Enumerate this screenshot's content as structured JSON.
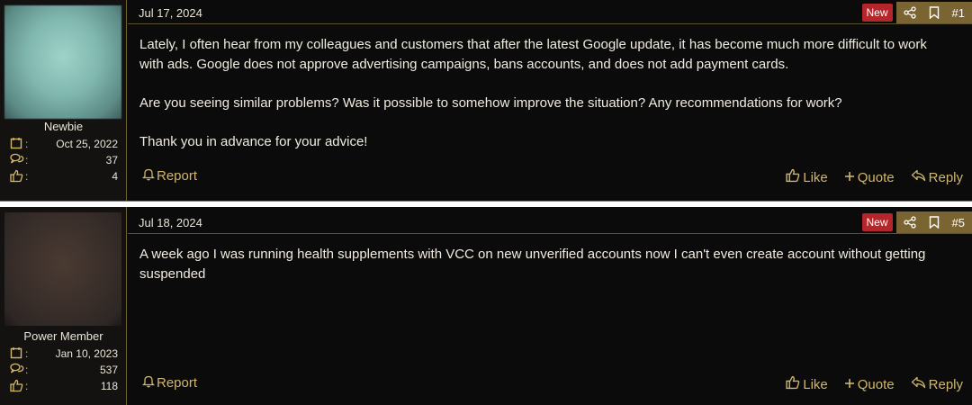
{
  "posts": [
    {
      "date": "Jul 17, 2024",
      "badge": "New",
      "post_number": "#1",
      "user": {
        "rank": "Newbie",
        "joined": "Oct 25, 2022",
        "messages": "37",
        "reactions": "4"
      },
      "body": [
        "Lately, I often hear from my colleagues and customers that after the latest Google update, it has become much more difficult to work with ads. Google does not approve advertising campaigns, bans accounts, and does not add payment cards.",
        "Are you seeing similar problems? Was it possible to somehow improve the situation? Any recommendations for work?",
        "Thank you in advance for your advice!"
      ],
      "report_label": "Report",
      "like_label": "Like",
      "quote_label": "Quote",
      "reply_label": "Reply"
    },
    {
      "date": "Jul 18, 2024",
      "badge": "New",
      "post_number": "#5",
      "user": {
        "rank": "Power Member",
        "joined": "Jan 10, 2023",
        "messages": "537",
        "reactions": "118"
      },
      "body": [
        "A week ago I was running health supplements with VCC on new unverified accounts now I can't even create account without getting suspended"
      ],
      "report_label": "Report",
      "like_label": "Like",
      "quote_label": "Quote",
      "reply_label": "Reply"
    }
  ],
  "colors": {
    "accent": "#cfb56d",
    "badge_new": "#b5262b",
    "gold_box": "#7a6432",
    "background": "#0b0b0b"
  },
  "icons": [
    "calendar-icon",
    "messages-icon",
    "thumbs-up-icon",
    "share-icon",
    "bookmark-icon",
    "bell-icon",
    "plus-icon",
    "reply-icon"
  ]
}
